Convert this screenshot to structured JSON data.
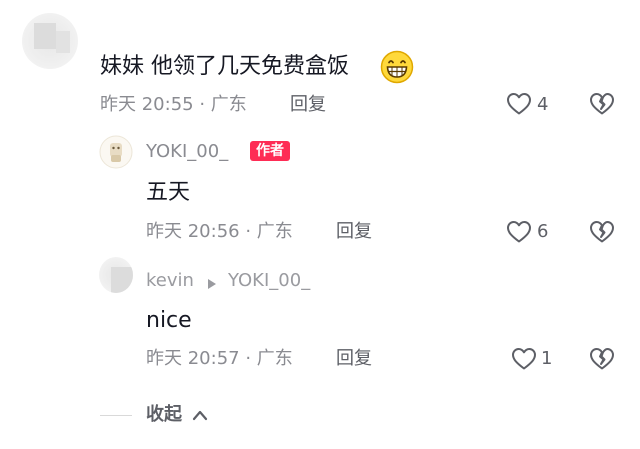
{
  "comment": {
    "text": "妹妹 他领了几天免费盒饭",
    "emoji": "grinning-face-emoji",
    "meta": "昨天 20:55 · 广东",
    "reply_label": "回复",
    "likes": "4"
  },
  "replies": [
    {
      "username": "YOKI_00_",
      "badge": "作者",
      "text": "五天",
      "meta": "昨天 20:56 · 广东",
      "reply_label": "回复",
      "likes": "6"
    },
    {
      "username": "kevin",
      "reply_to": "YOKI_00_",
      "text": "nice",
      "meta": "昨天 20:57 · 广东",
      "reply_label": "回复",
      "likes": "1"
    }
  ],
  "collapse_label": "收起",
  "colors": {
    "badge": "#fe2c55",
    "meta_text": "#8a8b91",
    "primary_text": "#161823"
  },
  "icons": [
    "heart-outline-icon",
    "broken-heart-icon",
    "chevron-up-icon",
    "reply-arrow-icon"
  ]
}
